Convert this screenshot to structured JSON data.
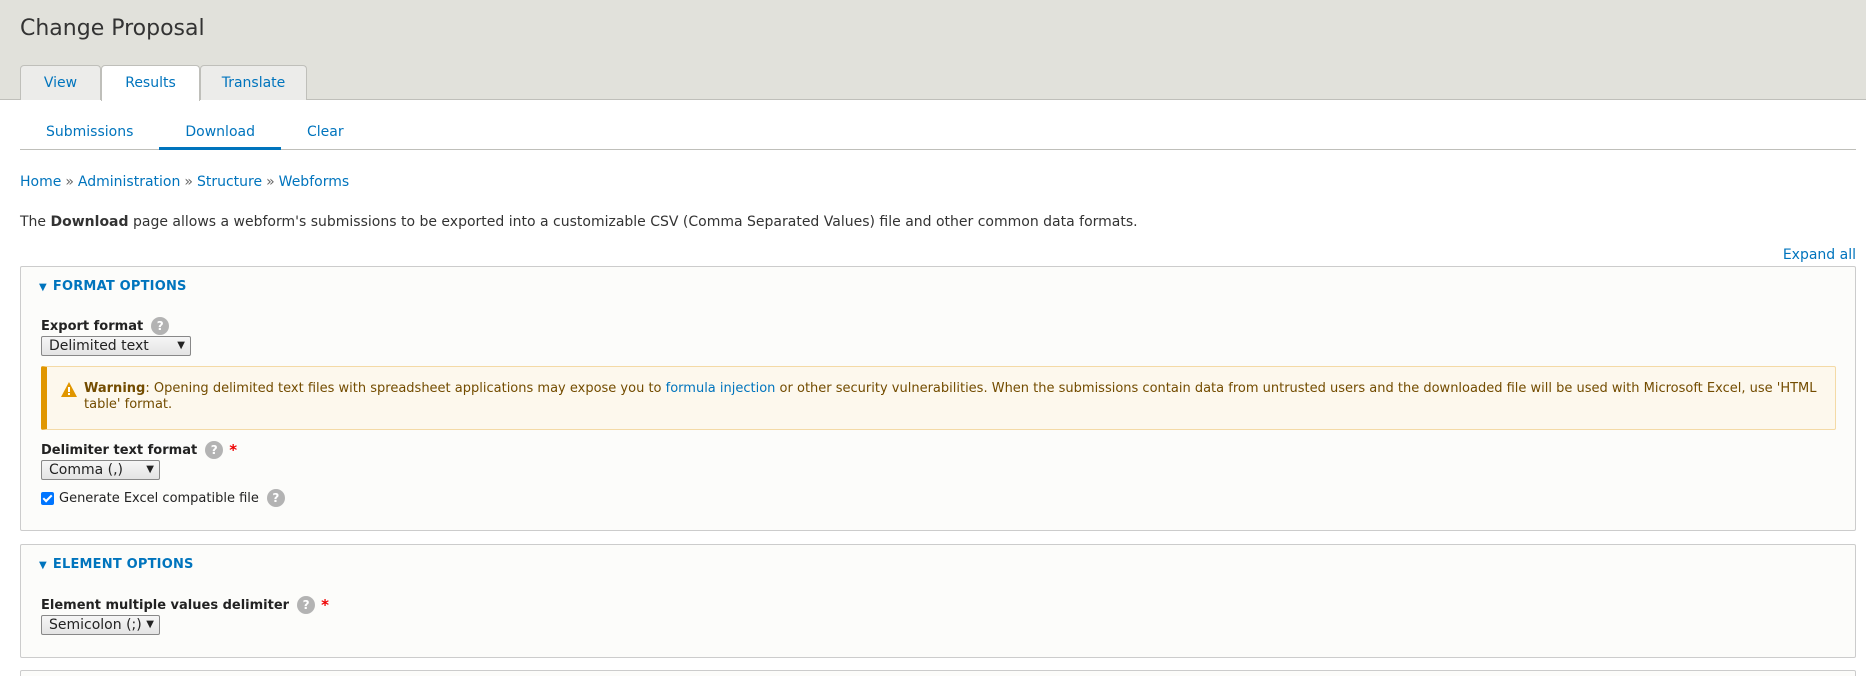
{
  "page": {
    "title": "Change Proposal"
  },
  "primary_tabs": [
    {
      "label": "View"
    },
    {
      "label": "Results"
    },
    {
      "label": "Translate"
    }
  ],
  "secondary_tabs": [
    {
      "label": "Submissions"
    },
    {
      "label": "Download"
    },
    {
      "label": "Clear"
    }
  ],
  "breadcrumb": {
    "items": [
      "Home",
      "Administration",
      "Structure",
      "Webforms"
    ],
    "separator": "»"
  },
  "intro": {
    "prefix": "The ",
    "bold": "Download",
    "suffix": " page allows a webform's submissions to be exported into a customizable CSV (Comma Separated Values) file and other common data formats."
  },
  "expand_all": "Expand all",
  "format_options": {
    "title": "FORMAT OPTIONS",
    "export_format_label": "Export format",
    "export_format_value": "Delimited text",
    "warning": {
      "label": "Warning",
      "text_before": ": Opening delimited text files with spreadsheet applications may expose you to ",
      "link": "formula injection",
      "text_after": " or other security vulnerabilities. When the submissions contain data from untrusted users and the downloaded file will be used with Microsoft Excel, use 'HTML table' format."
    },
    "delimiter_label": "Delimiter text format",
    "delimiter_value": "Comma (,)",
    "excel_checkbox_label": "Generate Excel compatible file",
    "excel_checked": true
  },
  "element_options": {
    "title": "ELEMENT OPTIONS",
    "multi_delim_label": "Element multiple values delimiter",
    "multi_delim_value": "Semicolon (;)"
  },
  "icons": {
    "help": "?",
    "required": "*",
    "collapse": "▼",
    "dropdown": "▼"
  },
  "colors": {
    "link": "#0074bd",
    "warning_border": "#e09600",
    "required": "#e00000"
  }
}
